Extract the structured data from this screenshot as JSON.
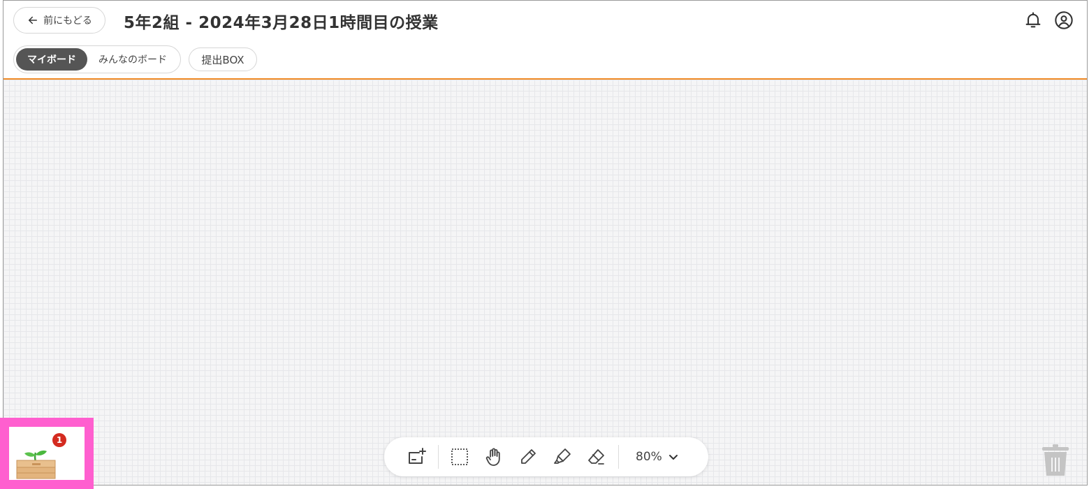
{
  "header": {
    "back_label": "前にもどる",
    "title": "5年2組 - 2024年3月28日1時間目の授業"
  },
  "tabs": {
    "my_board": "マイボード",
    "everyone_board": "みんなのボード",
    "submit_box": "提出BOX"
  },
  "toolbar": {
    "zoom_value": "80%",
    "tools": [
      "add-card-icon",
      "select-area-icon",
      "hand-icon",
      "pencil-icon",
      "highlighter-icon",
      "eraser-icon"
    ]
  },
  "inbox": {
    "badge_count": "1"
  },
  "colors": {
    "accent": "#f08a24",
    "active_tab": "#555555",
    "badge": "#d42b20",
    "highlight_frame": "#ff5fcf"
  }
}
